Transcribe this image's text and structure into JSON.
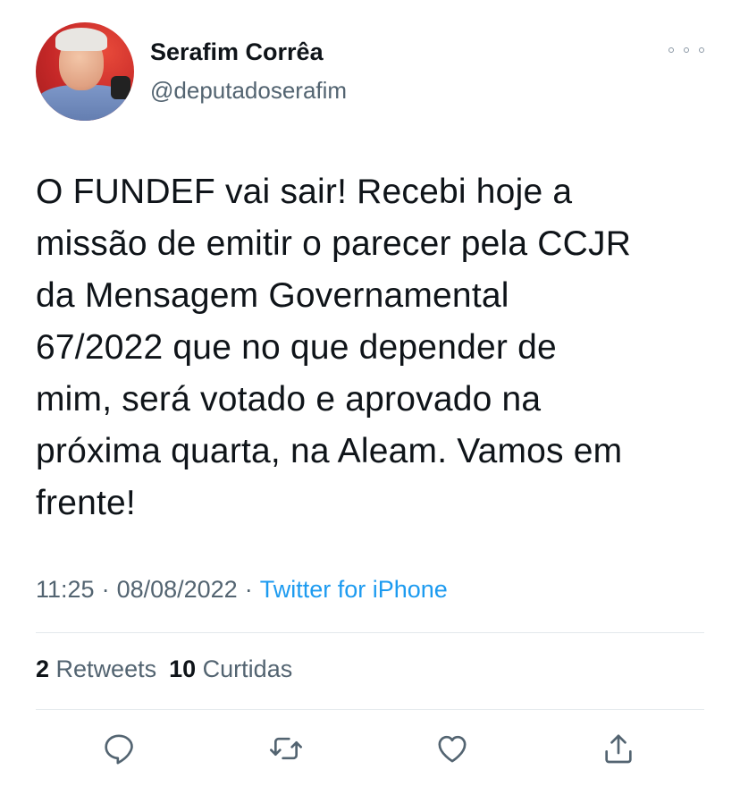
{
  "author": {
    "name": "Serafim Corrêa",
    "handle": "@deputadoserafim"
  },
  "tweet": {
    "lines": [
      "O FUNDEF vai sair! Recebi hoje a",
      "missão de emitir o parecer pela CCJR",
      "da Mensagem Governamental",
      "67/2022 que no que depender de",
      "mim, será votado e aprovado na",
      "próxima quarta, na Aleam. Vamos em",
      "frente!"
    ]
  },
  "meta": {
    "time": "11:25",
    "date": "08/08/2022",
    "separator": "·",
    "source": "Twitter for iPhone"
  },
  "stats": {
    "retweets_count": "2",
    "retweets_label": "Retweets",
    "likes_count": "10",
    "likes_label": "Curtidas"
  },
  "icons": {
    "more": "more-horizontal-icon",
    "reply": "reply-icon",
    "retweet": "retweet-icon",
    "like": "heart-icon",
    "share": "share-icon"
  },
  "colors": {
    "text": "#0f1419",
    "secondary": "#536471",
    "link": "#1d9bf0",
    "divider": "#e3e8ec"
  }
}
